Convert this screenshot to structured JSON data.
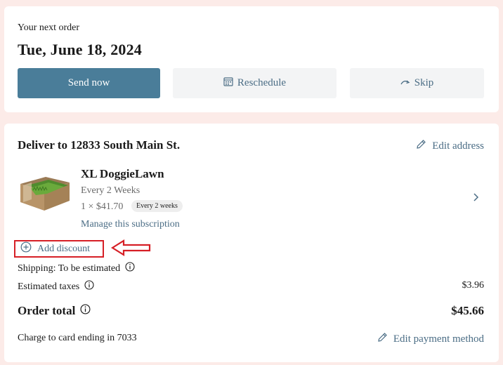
{
  "next_order": {
    "label": "Your next order",
    "date": "Tue, June 18, 2024",
    "send_now": "Send now",
    "reschedule": "Reschedule",
    "skip": "Skip"
  },
  "delivery": {
    "title": "Deliver to 12833 South Main St.",
    "edit_address": "Edit address"
  },
  "product": {
    "name": "XL DoggieLawn",
    "frequency": "Every 2 Weeks",
    "price": "1 × $41.70",
    "badge": "Every 2 weeks",
    "manage": "Manage this subscription"
  },
  "discount": {
    "label": "Add discount"
  },
  "summary": {
    "shipping": "Shipping: To be estimated",
    "taxes_label": "Estimated taxes",
    "taxes_value": "$3.96",
    "total_label": "Order total",
    "total_value": "$45.66",
    "charge": "Charge to card ending in 7033",
    "edit_payment": "Edit payment method"
  },
  "colors": {
    "background": "#fcebe8",
    "primary_button": "#4a7d99",
    "link": "#4b6d85",
    "annotation_red": "#d61f26"
  },
  "icons": [
    "calendar-icon",
    "skip-arrow-icon",
    "pencil-icon",
    "chevron-right-icon",
    "plus-circle-icon",
    "info-icon",
    "annotation-arrow"
  ]
}
